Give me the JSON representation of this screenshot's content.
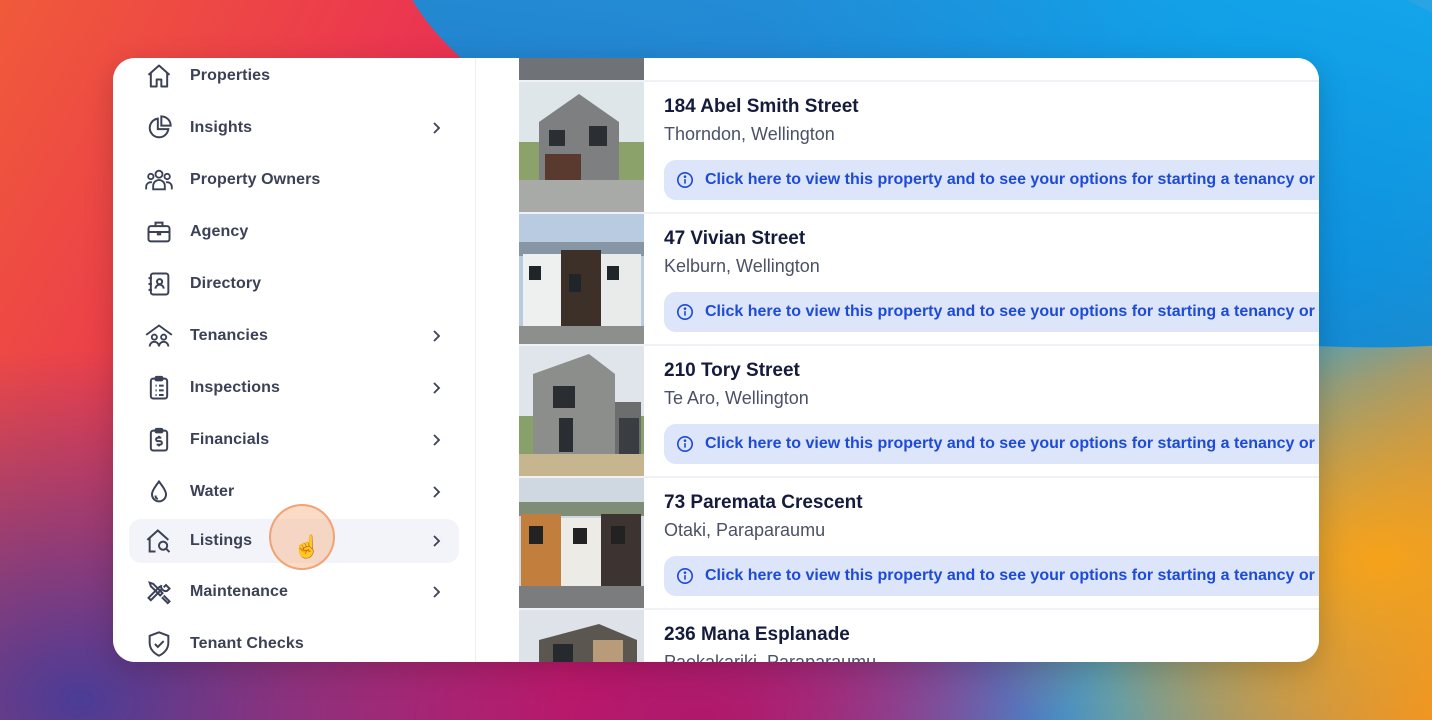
{
  "sidebar": {
    "items": [
      {
        "label": "Properties",
        "icon": "home-icon",
        "chevron": false
      },
      {
        "label": "Insights",
        "icon": "pie-chart-icon",
        "chevron": true
      },
      {
        "label": "Property Owners",
        "icon": "people-group-icon",
        "chevron": false
      },
      {
        "label": "Agency",
        "icon": "briefcase-icon",
        "chevron": false
      },
      {
        "label": "Directory",
        "icon": "contact-book-icon",
        "chevron": false
      },
      {
        "label": "Tenancies",
        "icon": "tenancy-house-people-icon",
        "chevron": true
      },
      {
        "label": "Inspections",
        "icon": "clipboard-list-icon",
        "chevron": true
      },
      {
        "label": "Financials",
        "icon": "clipboard-dollar-icon",
        "chevron": true
      },
      {
        "label": "Water",
        "icon": "water-drop-icon",
        "chevron": true
      },
      {
        "label": "Listings",
        "icon": "house-search-icon",
        "chevron": true,
        "active": true
      },
      {
        "label": "Maintenance",
        "icon": "tools-icon",
        "chevron": true
      },
      {
        "label": "Tenant Checks",
        "icon": "shield-check-icon",
        "chevron": false
      }
    ]
  },
  "listings": [
    {
      "address": "184 Abel Smith Street",
      "suburb": "Thorndon, Wellington",
      "banner": "Click here to view this property and to see your options for starting a tenancy or"
    },
    {
      "address": "47 Vivian Street",
      "suburb": "Kelburn, Wellington",
      "banner": "Click here to view this property and to see your options for starting a tenancy or"
    },
    {
      "address": "210 Tory Street",
      "suburb": "Te Aro, Wellington",
      "banner": "Click here to view this property and to see your options for starting a tenancy or"
    },
    {
      "address": "73 Paremata Crescent",
      "suburb": "Otaki, Paraparaumu",
      "banner": "Click here to view this property and to see your options for starting a tenancy or"
    },
    {
      "address": "236 Mana Esplanade",
      "suburb": "Paekakariki, Paraparaumu",
      "banner": ""
    }
  ],
  "colors": {
    "accent": "#1d4bd6",
    "banner_bg": "#dde5fb",
    "nav_text": "#3b4156",
    "title": "#141b3c"
  }
}
